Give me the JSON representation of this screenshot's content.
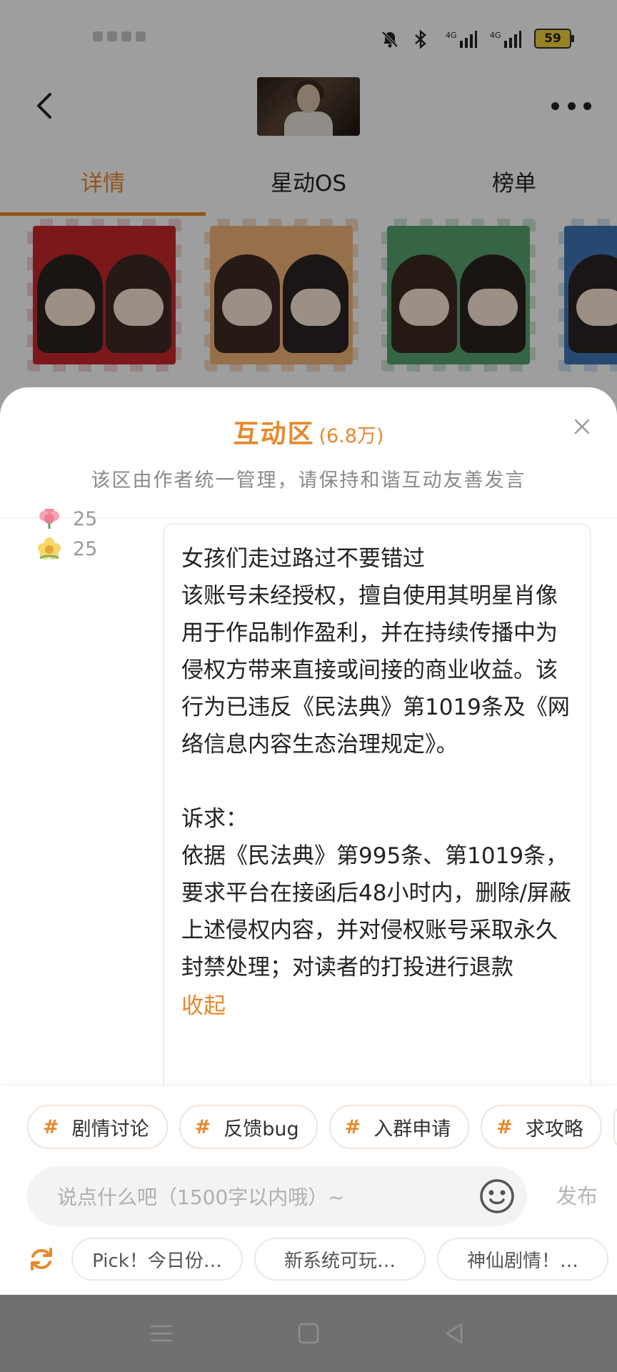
{
  "status_bar": {
    "battery_level": "59",
    "network_1": "4G",
    "network_2": "4G"
  },
  "nav": {
    "back_icon": "chevron-left-icon",
    "more_icon": "more-horizontal-icon"
  },
  "tabs": [
    {
      "label": "详情",
      "active": true
    },
    {
      "label": "星动OS",
      "active": false
    },
    {
      "label": "榜单",
      "active": false
    }
  ],
  "sheet": {
    "title": "互动区",
    "count": "(6.8万)",
    "subtitle": "该区由作者统一管理，请保持和谐互动友善发言",
    "close_icon": "close-icon"
  },
  "reactions": [
    {
      "icon": "flower-icon",
      "count": "25"
    },
    {
      "icon": "sun-flower-icon",
      "count": "25"
    }
  ],
  "comment": {
    "paragraphs": [
      "女孩们走过路过不要错过",
      "该账号未经授权，擅自使用其明星肖像用于作品制作盈利，并在持续传播中为侵权方带来直接或间接的商业收益。该行为已违反《民法典》第1019条及《网络信息内容生态治理规定》。",
      "",
      "诉求：",
      "依据《民法典》第995条、第1019条，要求平台在接函后48小时内，删除/屏蔽上述侵权内容，并对侵权账号采取永久封禁处理；对读者的打投进行退款"
    ],
    "collapse_label": "收起"
  },
  "topic_tags": [
    {
      "label": "剧情讨论"
    },
    {
      "label": "反馈bug"
    },
    {
      "label": "入群申请"
    },
    {
      "label": "求攻略"
    }
  ],
  "input": {
    "placeholder": "说点什么吧（1500字以内哦）~",
    "value": "",
    "publish_label": "发布",
    "emoji_icon": "smiley-icon"
  },
  "quick_replies": [
    {
      "label": "Pick！今日份…"
    },
    {
      "label": "新系统可玩…"
    },
    {
      "label": "神仙剧情！…"
    }
  ],
  "colors": {
    "accent": "#e8882b",
    "overlay": "rgba(0,0,0,0.38)"
  }
}
